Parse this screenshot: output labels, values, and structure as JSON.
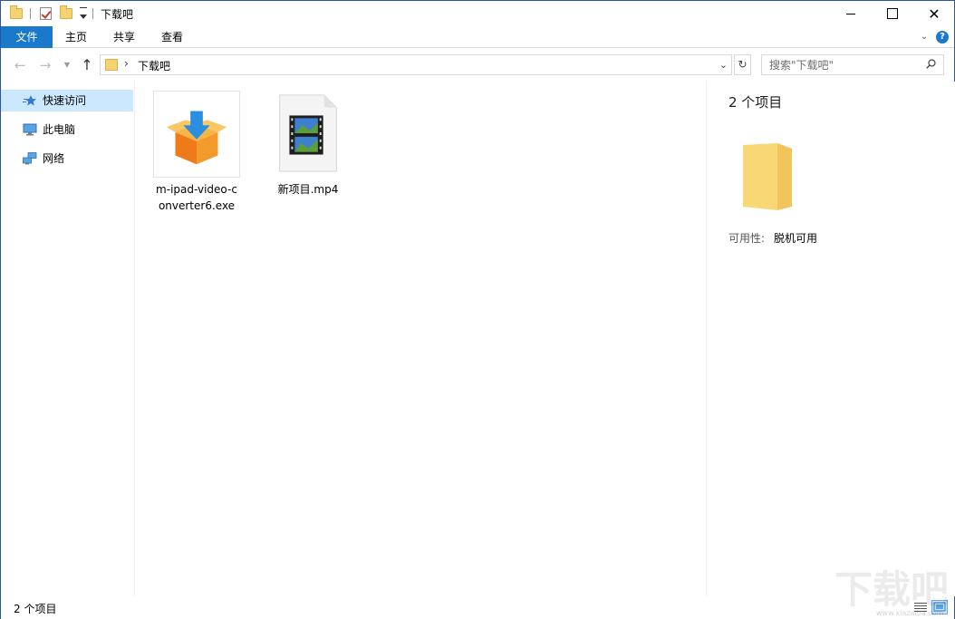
{
  "window": {
    "title": "下载吧",
    "accent": "#1979ca"
  },
  "ribbon": {
    "tabs": [
      {
        "label": "文件",
        "active": true
      },
      {
        "label": "主页"
      },
      {
        "label": "共享"
      },
      {
        "label": "查看"
      }
    ],
    "help_glyph": "?"
  },
  "nav": {
    "path_segment": "下载吧",
    "search_placeholder": "搜索\"下载吧\""
  },
  "sidebar": {
    "items": [
      {
        "label": "快速访问",
        "icon": "star-icon",
        "selected": true
      },
      {
        "label": "此电脑",
        "icon": "computer-icon"
      },
      {
        "label": "网络",
        "icon": "network-icon"
      }
    ]
  },
  "files": [
    {
      "name": "m-ipad-video-converter6.exe",
      "icon": "installer-box-icon"
    },
    {
      "name": "新项目.mp4",
      "icon": "video-file-icon"
    }
  ],
  "details": {
    "count": "2 个项目",
    "prop_label": "可用性:",
    "prop_value": "脱机可用"
  },
  "status": {
    "text": "2 个项目"
  },
  "watermark": {
    "text": "下载吧",
    "sub": "www.xiazaiba.com"
  }
}
